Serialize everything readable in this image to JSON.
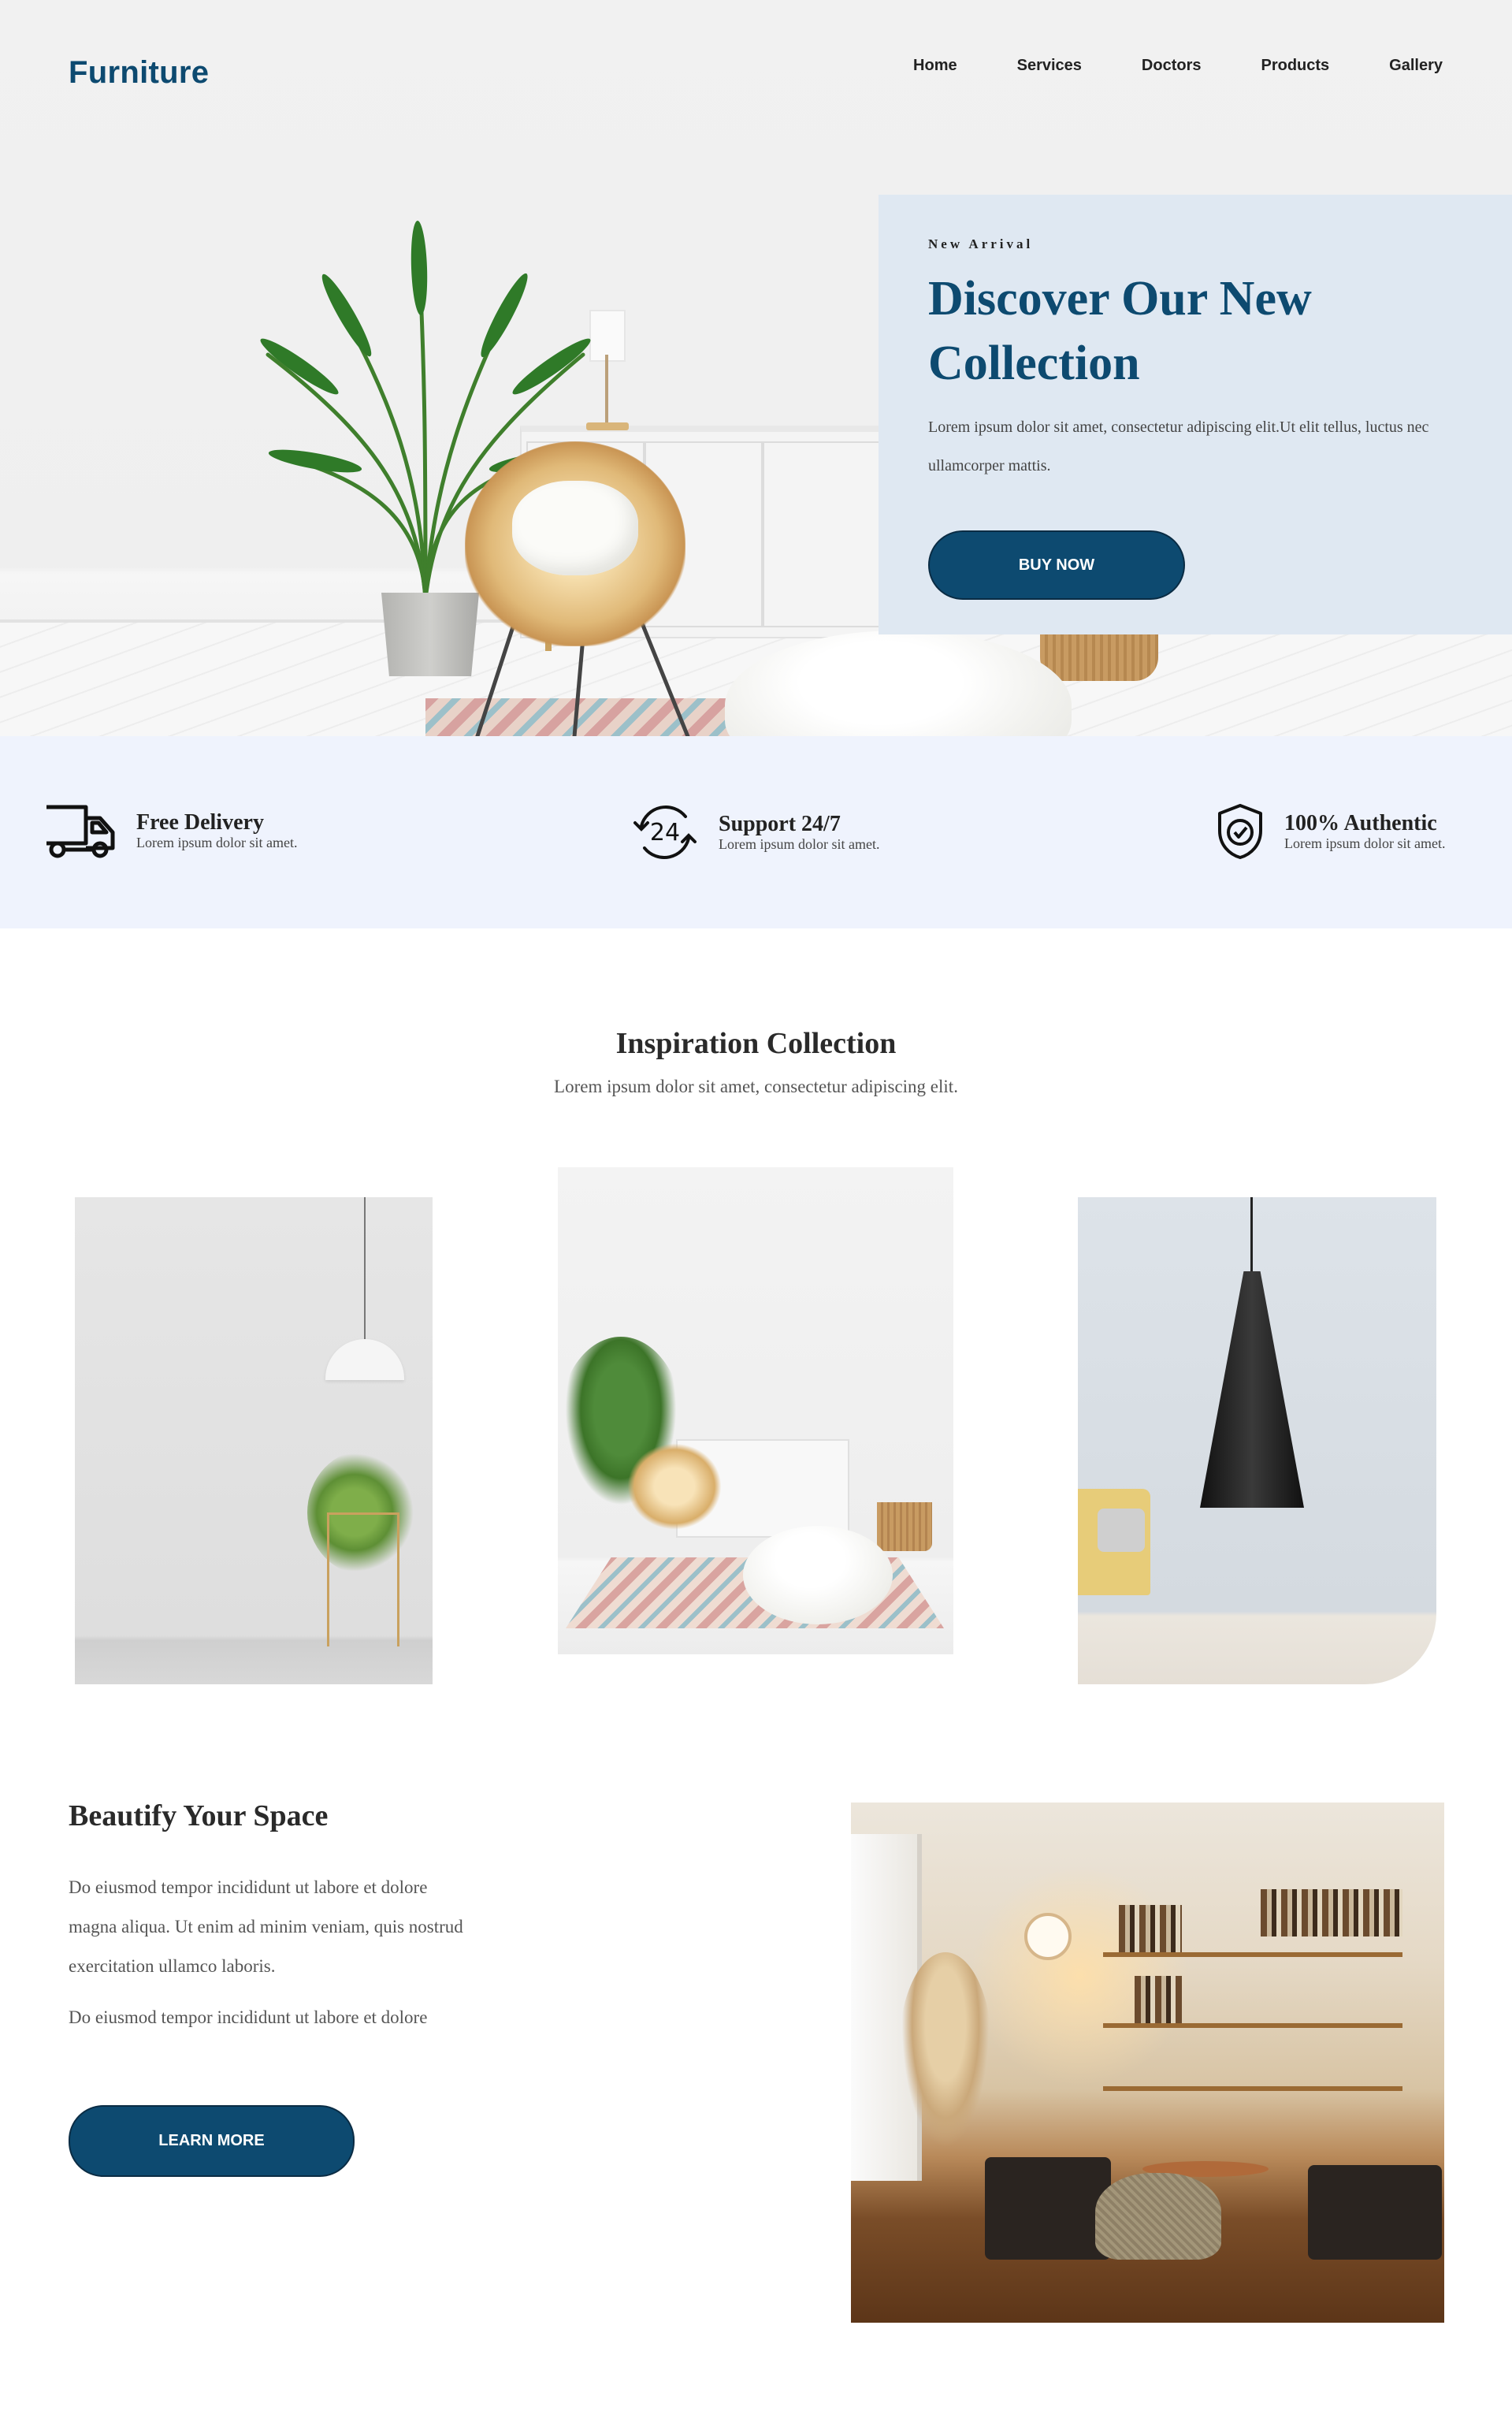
{
  "brand": {
    "logo": "Furniture",
    "accent_color": "#0d4a70"
  },
  "nav": {
    "items": [
      {
        "label": "Home"
      },
      {
        "label": "Services"
      },
      {
        "label": "Doctors"
      },
      {
        "label": "Products"
      },
      {
        "label": "Gallery"
      }
    ]
  },
  "hero": {
    "kicker": "New Arrival",
    "title": "Discover Our New Collection",
    "text": "Lorem ipsum dolor sit amet, consectetur adipiscing elit.Ut elit tellus, luctus nec ullamcorper mattis.",
    "button_label": "BUY NOW"
  },
  "features": [
    {
      "icon": "delivery-truck-icon",
      "title": "Free Delivery",
      "text": "Lorem ipsum dolor sit amet."
    },
    {
      "icon": "support-24-icon",
      "title": "Support 24/7",
      "text": "Lorem ipsum dolor sit amet."
    },
    {
      "icon": "shield-check-icon",
      "title": "100% Authentic",
      "text": "Lorem ipsum dolor sit amet."
    }
  ],
  "inspiration": {
    "title": "Inspiration Collection",
    "subtitle": "Lorem ipsum dolor sit amet, consectetur adipiscing elit."
  },
  "beautify": {
    "title": "Beautify Your Space",
    "paragraph_1": "Do eiusmod tempor incididunt ut labore et dolore magna aliqua. Ut enim ad minim veniam, quis nostrud exercitation ullamco laboris.",
    "paragraph_2": "Do eiusmod tempor incididunt ut labore et dolore",
    "button_label": "LEARN MORE"
  }
}
